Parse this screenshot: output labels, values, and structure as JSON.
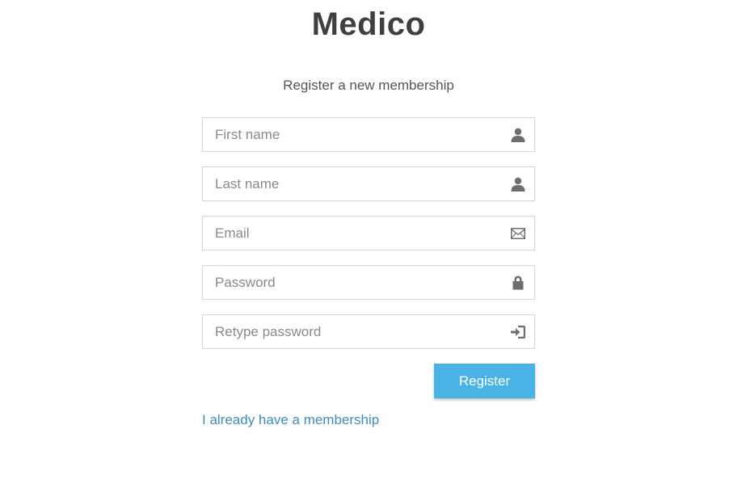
{
  "brand": {
    "title": "Medico"
  },
  "header": {
    "subtitle": "Register a new membership"
  },
  "form": {
    "fields": [
      {
        "placeholder": "First name",
        "value": "",
        "icon": "user-icon"
      },
      {
        "placeholder": "Last name",
        "value": "",
        "icon": "user-icon"
      },
      {
        "placeholder": "Email",
        "value": "",
        "icon": "envelope-icon"
      },
      {
        "placeholder": "Password",
        "value": "",
        "icon": "lock-icon"
      },
      {
        "placeholder": "Retype password",
        "value": "",
        "icon": "log-in-icon"
      }
    ],
    "register_label": "Register"
  },
  "footer": {
    "login_link": "I already have a membership"
  },
  "colors": {
    "accent": "#4ab3e6",
    "link": "#3c8dbc",
    "brand_text": "#3f3f3f",
    "border": "#d2d6de"
  }
}
